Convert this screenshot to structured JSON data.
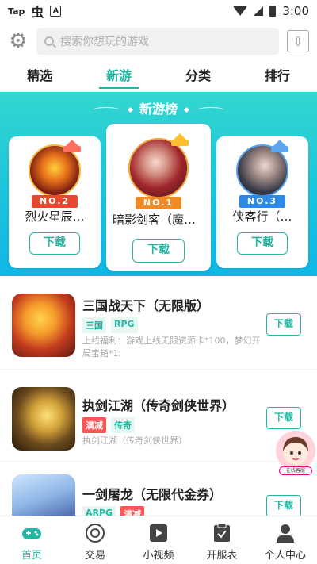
{
  "status_bar": {
    "left_icons": [
      "taptap-icon",
      "bug-icon",
      "a-icon"
    ],
    "taptap_text": "Tap",
    "a_label": "A",
    "time": "3:00"
  },
  "search": {
    "placeholder": "搜索你想玩的游戏"
  },
  "tabs": [
    {
      "label": "精选",
      "active": false
    },
    {
      "label": "新游",
      "active": true
    },
    {
      "label": "分类",
      "active": false
    },
    {
      "label": "排行",
      "active": false
    }
  ],
  "ranking": {
    "title": "新游榜",
    "download_label": "下载",
    "cards": [
      {
        "rank": "NO.2",
        "name": "烈火星辰…"
      },
      {
        "rank": "NO.1",
        "name": "暗影剑客（魔法爆…"
      },
      {
        "rank": "NO.3",
        "name": "侠客行（…"
      }
    ]
  },
  "games": [
    {
      "title": "三国战天下（无限版）",
      "tags": [
        {
          "text": "三国",
          "style": "green"
        },
        {
          "text": "RPG",
          "style": "green"
        }
      ],
      "desc": "上线福利：游戏上线无限资源卡*100，梦幻开局宝箱*1;",
      "button": "下载"
    },
    {
      "title": "执剑江湖（传奇剑侠世界）",
      "tags": [
        {
          "text": "满减",
          "style": "red"
        },
        {
          "text": "传奇",
          "style": "green"
        }
      ],
      "desc": "执剑江湖（传奇剑侠世界）",
      "button": "下载"
    },
    {
      "title": "一剑屠龙（无限代金券）",
      "tags": [
        {
          "text": "ARPG",
          "style": "green"
        },
        {
          "text": "满减",
          "style": "red"
        }
      ],
      "desc": "",
      "button": "下载"
    }
  ],
  "service": {
    "label": "在线客服"
  },
  "bottom_nav": [
    {
      "label": "首页",
      "icon": "gamepad-icon",
      "active": true
    },
    {
      "label": "交易",
      "icon": "trade-icon",
      "active": false
    },
    {
      "label": "小视频",
      "icon": "video-icon",
      "active": false
    },
    {
      "label": "开服表",
      "icon": "calendar-icon",
      "active": false
    },
    {
      "label": "个人中心",
      "icon": "person-icon",
      "active": false
    }
  ],
  "colors": {
    "accent": "#21b7a3",
    "banner_top": "#33d6cf",
    "banner_bottom": "#10b7e6",
    "rank1": "#f08a24",
    "rank2": "#e6492d",
    "rank3": "#2d8ae6",
    "tag_red": "#ff5757"
  }
}
